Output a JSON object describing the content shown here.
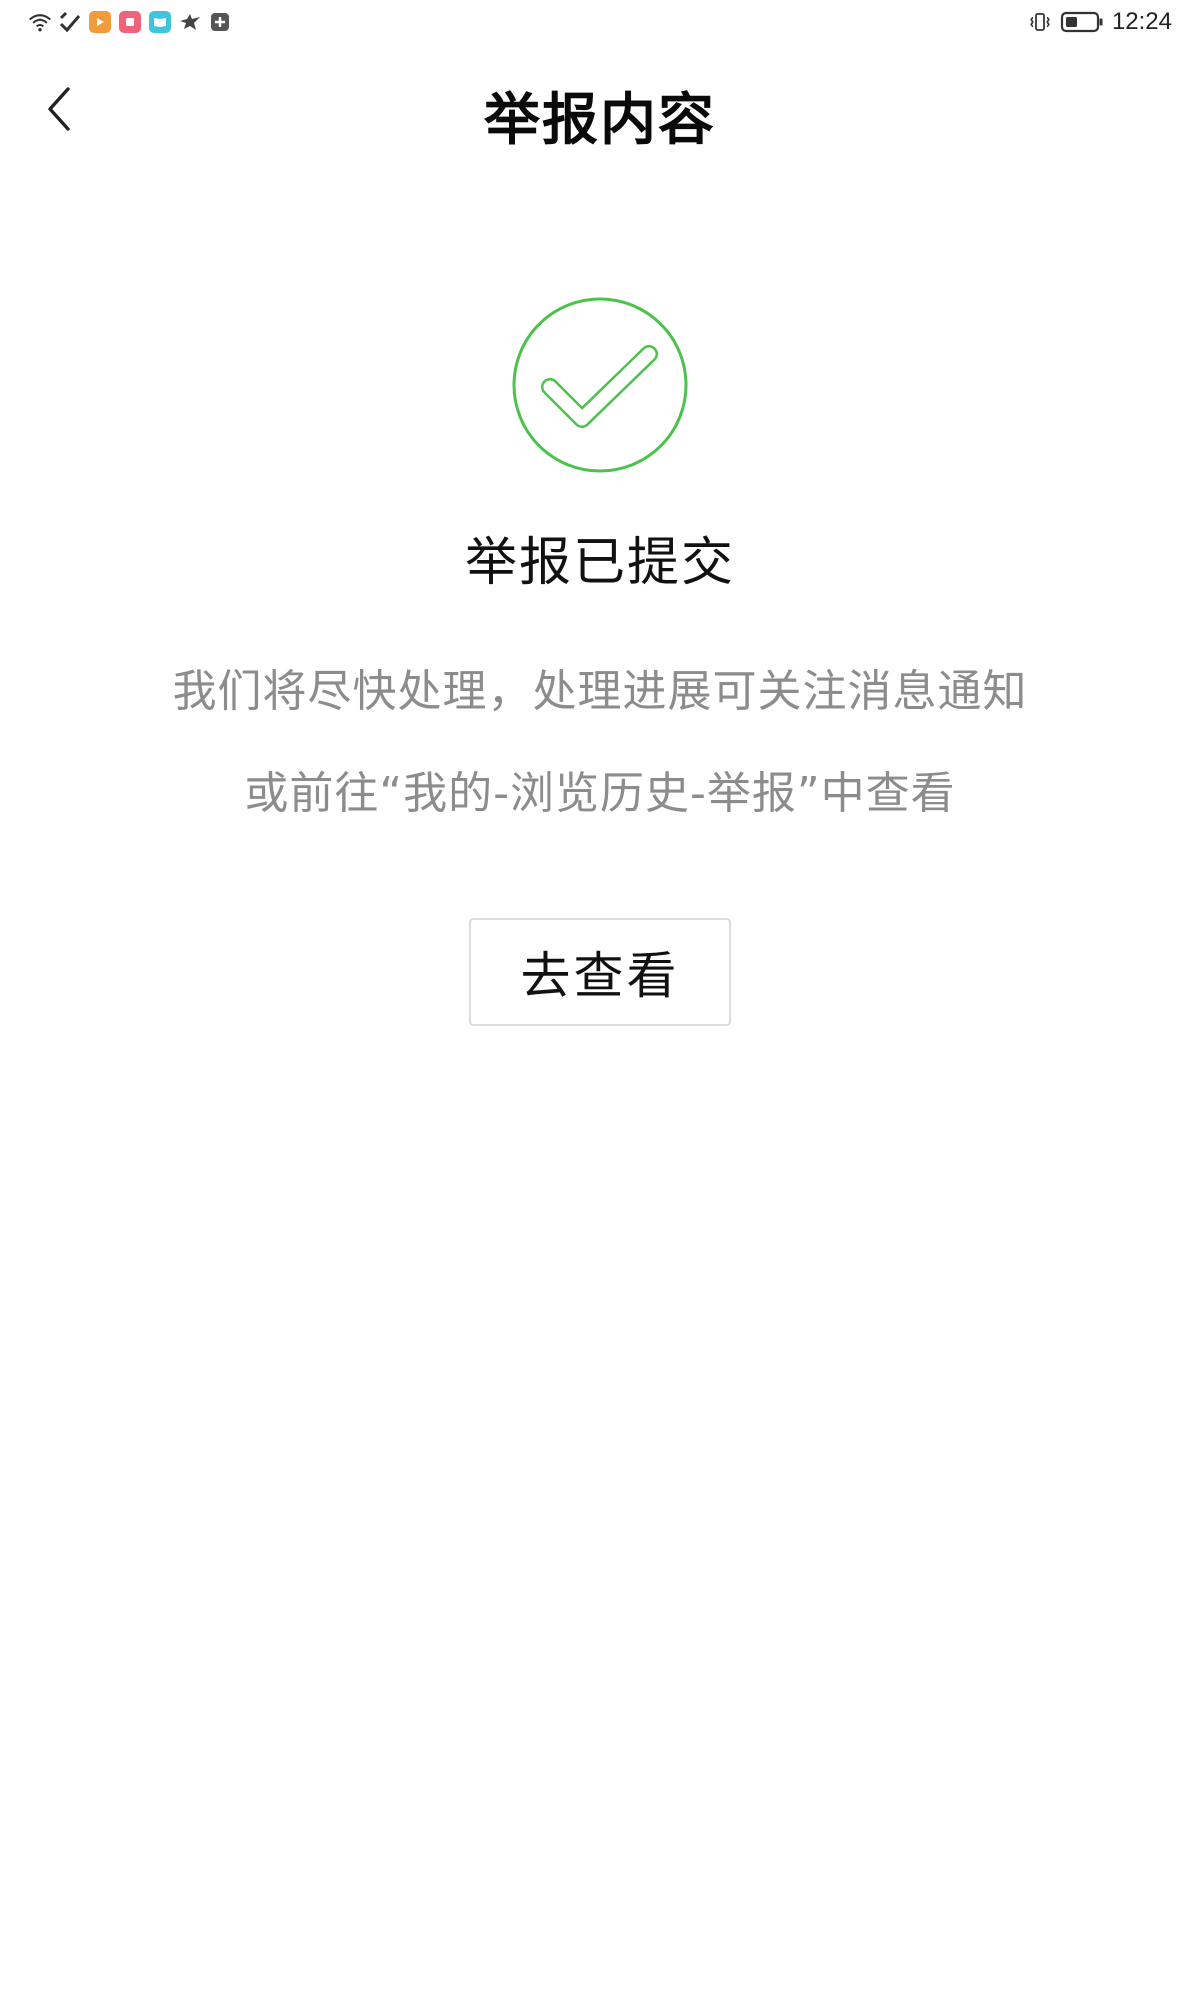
{
  "status_bar": {
    "left_icons": [
      "wifi-icon",
      "hotspot-icon",
      "app-notification-orange-icon",
      "app-notification-red-icon",
      "app-notification-blue-icon",
      "bird-icon",
      "add-box-icon"
    ],
    "right_icons": [
      "vibrate-icon",
      "battery-icon"
    ],
    "time": "12:24"
  },
  "nav": {
    "back_icon": "chevron-left-icon",
    "title": "举报内容"
  },
  "result": {
    "icon": "checkmark-circle-icon",
    "title": "举报已提交",
    "description_line1": "我们将尽快处理，处理进展可关注消息通知",
    "description_line2": "或前往“我的-浏览历史-举报”中查看",
    "view_button_label": "去查看"
  },
  "colors": {
    "success_green": "#4cc14c",
    "description_gray": "#8c8c8c",
    "button_border": "#dddddd",
    "app_orange": "#f39a3a",
    "app_red": "#f0647a",
    "app_blue": "#3dc4de"
  }
}
